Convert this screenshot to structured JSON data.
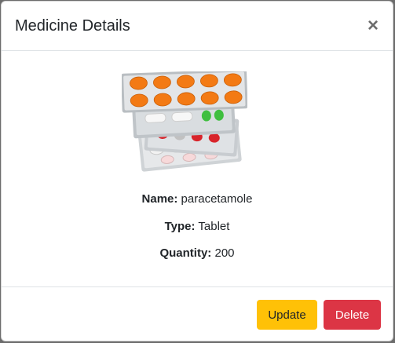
{
  "modal": {
    "title": "Medicine Details",
    "close_label": "×"
  },
  "image": {
    "alt": "Medicine blister packs"
  },
  "details": [
    {
      "label": "Name:",
      "value": " paracetamole"
    },
    {
      "label": "Type:",
      "value": " Tablet"
    },
    {
      "label": "Quantity:",
      "value": " 200"
    }
  ],
  "footer": {
    "update_label": "Update",
    "delete_label": "Delete"
  },
  "colors": {
    "update": "#ffc107",
    "delete": "#dc3545",
    "pill_orange": "#f37a14",
    "pill_green": "#3fbf3f",
    "pill_red": "#d8252b"
  }
}
